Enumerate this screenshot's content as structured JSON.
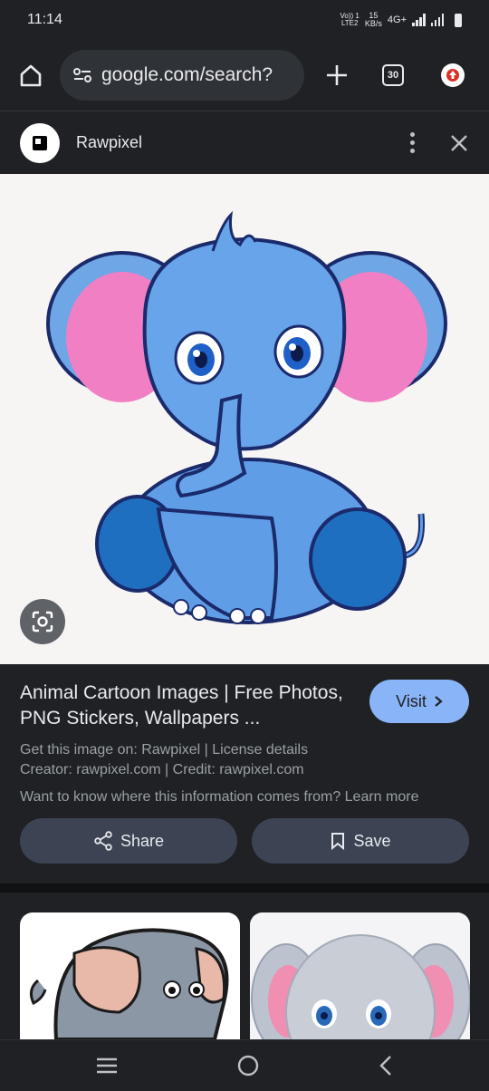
{
  "status": {
    "time": "11:14",
    "network_top": "Vo)) 1",
    "network_bottom": "LTE2",
    "speed_value": "15",
    "speed_unit": "KB/s",
    "signal_type": "4G+"
  },
  "browser": {
    "url": "google.com/search?",
    "tab_count": "30"
  },
  "source": {
    "name": "Rawpixel"
  },
  "result": {
    "title": "Animal Cartoon Images | Free Photos, PNG Stickers, Wallpapers ...",
    "visit_label": "Visit",
    "source_line": "Get this image on: Rawpixel | License details",
    "creator_line": "Creator: rawpixel.com | Credit: rawpixel.com",
    "learn_line": "Want to know where this information comes from? Learn more",
    "share_label": "Share",
    "save_label": "Save"
  },
  "colors": {
    "accent": "#8ab4f8",
    "background": "#1f2124",
    "button": "#3c4454"
  }
}
